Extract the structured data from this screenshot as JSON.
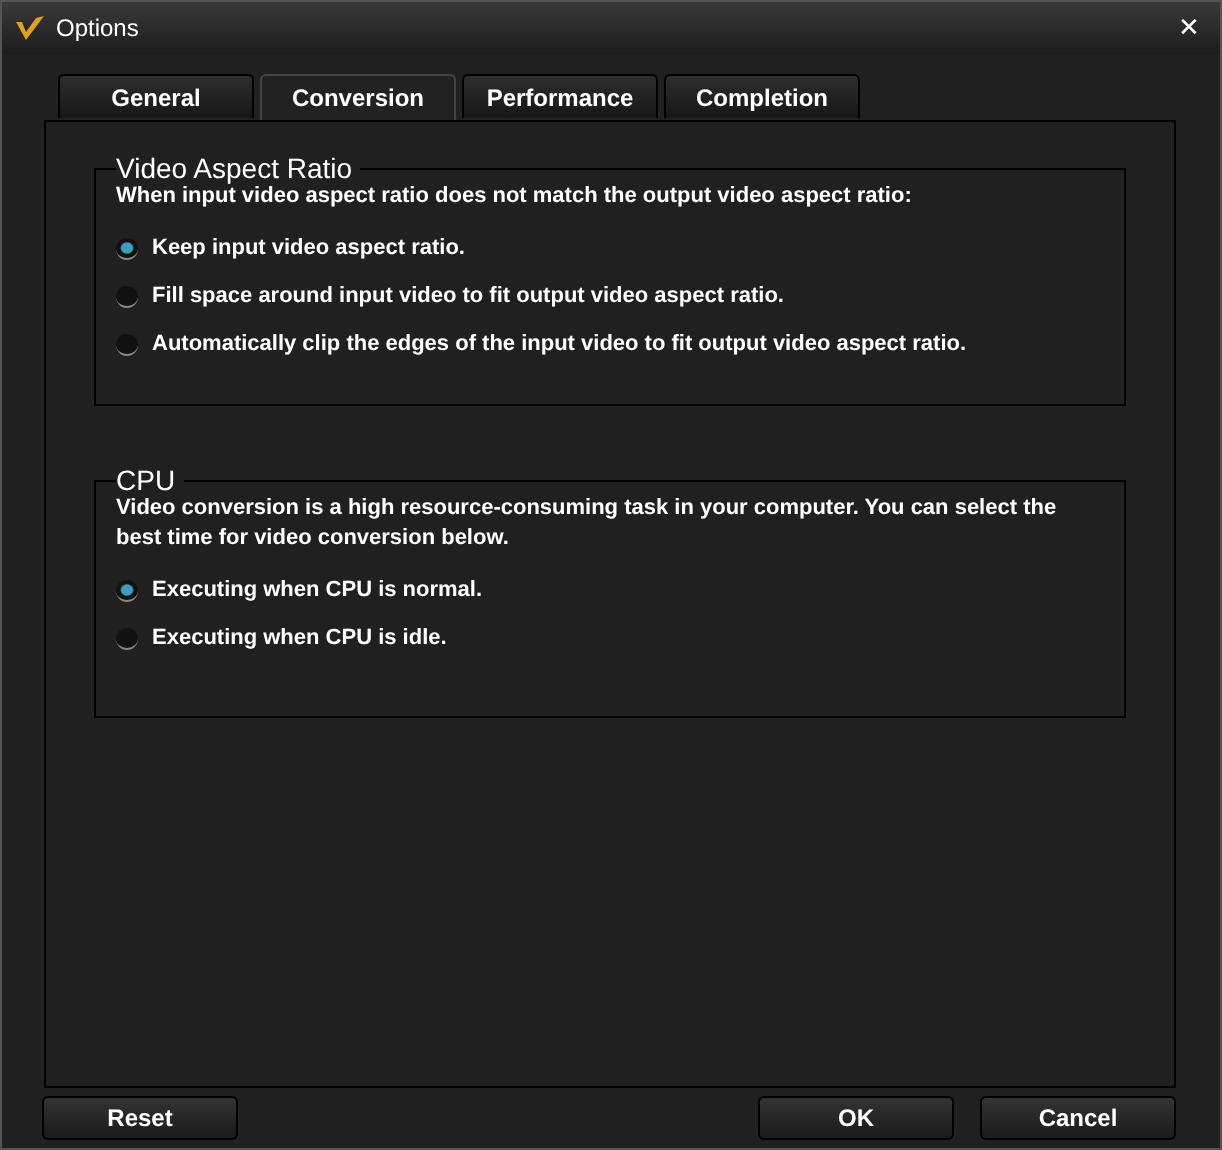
{
  "window": {
    "title": "Options",
    "close": "✕"
  },
  "tabs": [
    {
      "label": "General",
      "selected": false
    },
    {
      "label": "Conversion",
      "selected": true
    },
    {
      "label": "Performance",
      "selected": false
    },
    {
      "label": "Completion",
      "selected": false
    }
  ],
  "groups": [
    {
      "title": "Video Aspect Ratio",
      "description": "When input video aspect ratio does not match the output video aspect ratio:",
      "options": [
        {
          "label": "Keep input video aspect ratio.",
          "selected": true
        },
        {
          "label": "Fill space around input video to fit output video aspect ratio.",
          "selected": false
        },
        {
          "label": "Automatically clip the edges of the input video to fit output video aspect ratio.",
          "selected": false
        }
      ]
    },
    {
      "title": "CPU",
      "description": "Video conversion is a high resource-consuming task in your computer. You can select the best time for video conversion below.",
      "options": [
        {
          "label": "Executing when CPU is normal.",
          "selected": true
        },
        {
          "label": "Executing when CPU is idle.",
          "selected": false
        }
      ]
    }
  ],
  "buttons_left": [
    "Reset"
  ],
  "buttons_right": [
    "OK",
    "Cancel"
  ]
}
